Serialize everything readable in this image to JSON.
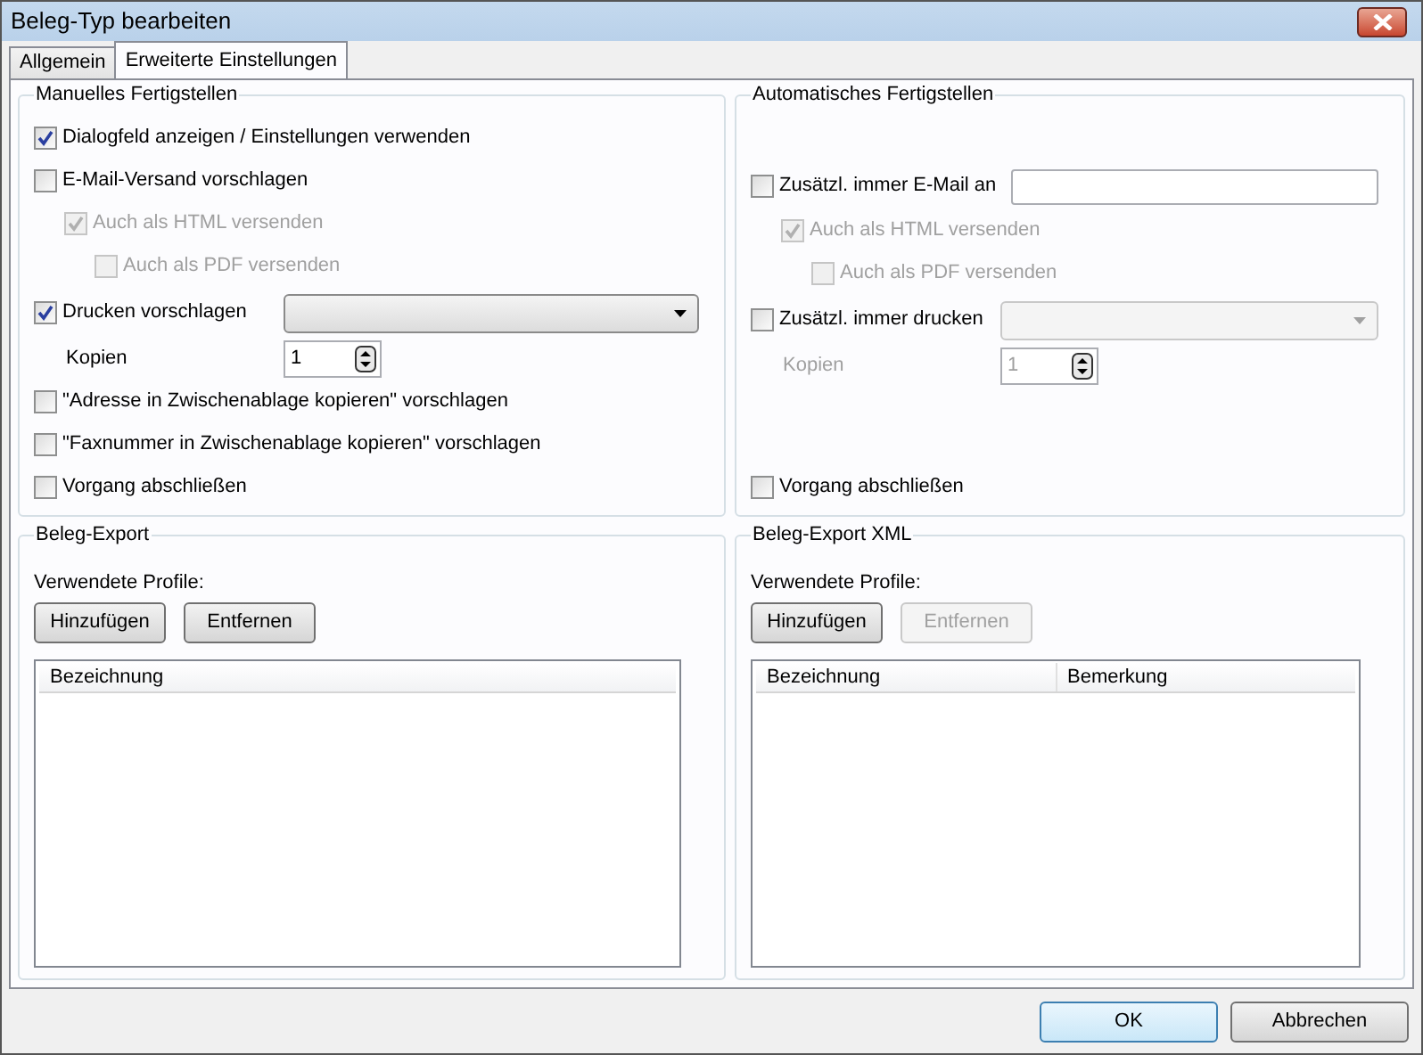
{
  "window": {
    "title": "Beleg-Typ bearbeiten"
  },
  "tabs": [
    {
      "label": "Allgemein",
      "selected": false
    },
    {
      "label": "Erweiterte Einstellungen",
      "selected": true
    }
  ],
  "groups": [
    {
      "title": "Manuelles Fertigstellen",
      "items": [
        {
          "kind": "checkbox",
          "label": "Dialogfeld anzeigen / Einstellungen verwenden",
          "checked": true,
          "disabled": false
        },
        {
          "kind": "checkbox",
          "label": "E-Mail-Versand vorschlagen",
          "checked": false,
          "disabled": false,
          "children": [
            {
              "label": "Auch als HTML versenden",
              "checked": true,
              "disabled": true,
              "children": [
                {
                  "label": "Auch als PDF versenden",
                  "checked": false,
                  "disabled": true
                }
              ]
            }
          ]
        },
        {
          "kind": "checkbox_dropdown",
          "label": "Drucken vorschlagen",
          "checked": true,
          "disabled": false,
          "dropdown_disabled": false
        },
        {
          "kind": "spinner",
          "label": "Kopien",
          "value": "1",
          "disabled": false
        },
        {
          "kind": "checkbox",
          "label": "\"Adresse in Zwischenablage kopieren\" vorschlagen",
          "checked": false,
          "disabled": false
        },
        {
          "kind": "checkbox",
          "label": "\"Faxnummer in Zwischenablage kopieren\" vorschlagen",
          "checked": false,
          "disabled": false
        }
      ],
      "closing": {
        "label": "Vorgang abschließen",
        "checked": false
      }
    },
    {
      "title": "Automatisches Fertigstellen",
      "items": [
        {
          "kind": "checkbox_input",
          "label": "Zusätzl. immer E-Mail an",
          "checked": false,
          "disabled": false,
          "children": [
            {
              "label": "Auch als HTML versenden",
              "checked": true,
              "disabled": true,
              "children": [
                {
                  "label": "Auch als PDF versenden",
                  "checked": false,
                  "disabled": true
                }
              ]
            }
          ]
        },
        {
          "kind": "checkbox_dropdown",
          "label": "Zusätzl. immer drucken",
          "checked": false,
          "disabled": false,
          "dropdown_disabled": true
        },
        {
          "kind": "spinner",
          "label": "Kopien",
          "value": "1",
          "disabled": true
        }
      ],
      "closing": {
        "label": "Vorgang abschließen",
        "checked": false
      }
    }
  ],
  "exports": [
    {
      "title": "Beleg-Export",
      "profiles_label": "Verwendete Profile:",
      "buttons": [
        {
          "label": "Hinzufügen",
          "disabled": false
        },
        {
          "label": "Entfernen",
          "disabled": false
        }
      ],
      "columns": [
        "Bezeichnung"
      ]
    },
    {
      "title": "Beleg-Export XML",
      "profiles_label": "Verwendete Profile:",
      "buttons": [
        {
          "label": "Hinzufügen",
          "disabled": false
        },
        {
          "label": "Entfernen",
          "disabled": true
        }
      ],
      "columns": [
        "Bezeichnung",
        "Bemerkung"
      ]
    }
  ],
  "footer_buttons": [
    {
      "label": "OK",
      "default": true
    },
    {
      "label": "Abbrechen",
      "default": false
    }
  ]
}
